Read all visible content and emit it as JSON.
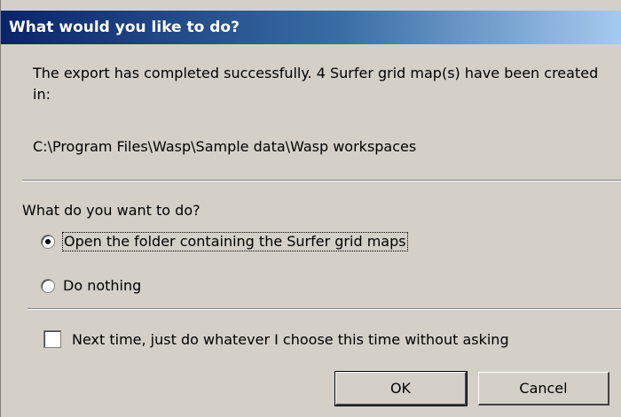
{
  "dialog": {
    "title": "What would you like to do?",
    "message": "The export has completed successfully. 4 Surfer grid map(s) have been created in:",
    "path": "C:\\Program Files\\Wasp\\Sample data\\Wasp workspaces",
    "question": "What do you want to do?",
    "options": [
      {
        "label": "Open the folder containing the Surfer grid maps",
        "selected": true
      },
      {
        "label": "Do nothing",
        "selected": false
      }
    ],
    "remember_checkbox": {
      "label": "Next time, just do whatever I choose this time without asking",
      "checked": false
    },
    "buttons": {
      "ok_label": "OK",
      "cancel_label": "Cancel"
    }
  },
  "colors": {
    "title_gradient_start": "#0a246a",
    "title_gradient_end": "#a6caf0",
    "dialog_background": "#d4d0c8"
  }
}
